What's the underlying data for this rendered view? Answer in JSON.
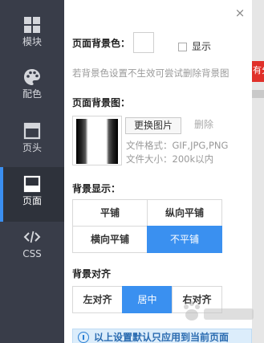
{
  "sidebar": {
    "items": [
      {
        "label": "模块",
        "icon": "grid-icon"
      },
      {
        "label": "配色",
        "icon": "palette-icon"
      },
      {
        "label": "页头",
        "icon": "header-icon"
      },
      {
        "label": "页面",
        "icon": "page-icon",
        "active": true
      },
      {
        "label": "CSS",
        "icon": "code-icon"
      }
    ],
    "colors": {
      "bg": "#393d49",
      "active_accent": "#3b8ff0"
    }
  },
  "panel": {
    "close_symbol": "×",
    "bg_color": {
      "label": "页面背景色：",
      "show_label": "显示",
      "show_checked": false,
      "hint": "若背景色设置不生效可尝试删除背景图"
    },
    "bg_image": {
      "label": "页面背景图：",
      "change_button": "更换图片",
      "delete_button": "删除",
      "format_text": "文件格式：GIF,JPG,PNG",
      "size_text": "文件大小：200k以内"
    },
    "bg_display": {
      "label": "背景显示：",
      "options": [
        "平铺",
        "纵向平铺",
        "横向平铺",
        "不平铺"
      ],
      "selected": "不平铺"
    },
    "bg_align": {
      "label": "背景对齐",
      "options": [
        "左对齐",
        "居中",
        "右对齐"
      ],
      "selected": "居中"
    },
    "notice": "以上设置默认只应用到当前页面",
    "accent_color": "#3a90f0"
  },
  "background_page": {
    "red_text": "有分"
  }
}
